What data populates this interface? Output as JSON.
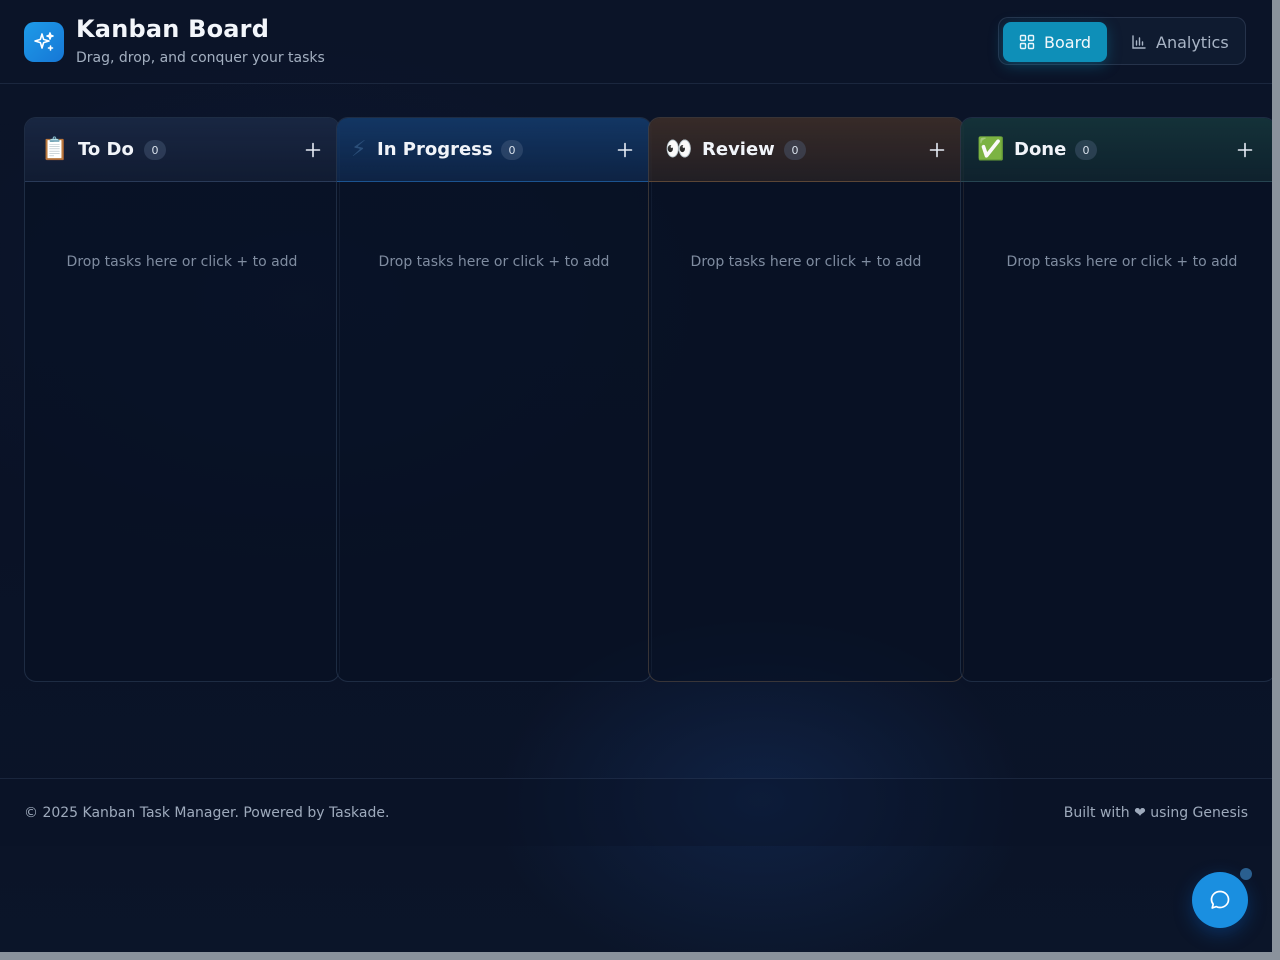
{
  "header": {
    "title": "Kanban Board",
    "subtitle": "Drag, drop, and conquer your tasks",
    "logo_icon": "sparkles-icon"
  },
  "view_switch": {
    "board_label": "Board",
    "analytics_label": "Analytics",
    "active": "Board",
    "board_icon": "grid-icon",
    "analytics_icon": "bar-chart-icon"
  },
  "columns": [
    {
      "emoji": "📋",
      "title": "To Do",
      "count": "0",
      "empty_text": "Drop tasks here or click + to add",
      "accent": "#1b2a45"
    },
    {
      "emoji": "⚡",
      "title": "In Progress",
      "count": "0",
      "empty_text": "Drop tasks here or click + to add",
      "accent": "#123a66"
    },
    {
      "emoji": "👀",
      "title": "Review",
      "count": "0",
      "empty_text": "Drop tasks here or click + to add",
      "accent": "#3a2e2a"
    },
    {
      "emoji": "✅",
      "title": "Done",
      "count": "0",
      "empty_text": "Drop tasks here or click + to add",
      "accent": "#16323a"
    }
  ],
  "footer": {
    "left": "© 2025 Kanban Task Manager. Powered by Taskade.",
    "right": "Built with ❤ using Genesis"
  },
  "chat": {
    "icon": "chat-bubble-icon"
  },
  "colors": {
    "accent": "#0e8fb8",
    "brand": "#1a8fe0",
    "background": "#0a1226"
  }
}
